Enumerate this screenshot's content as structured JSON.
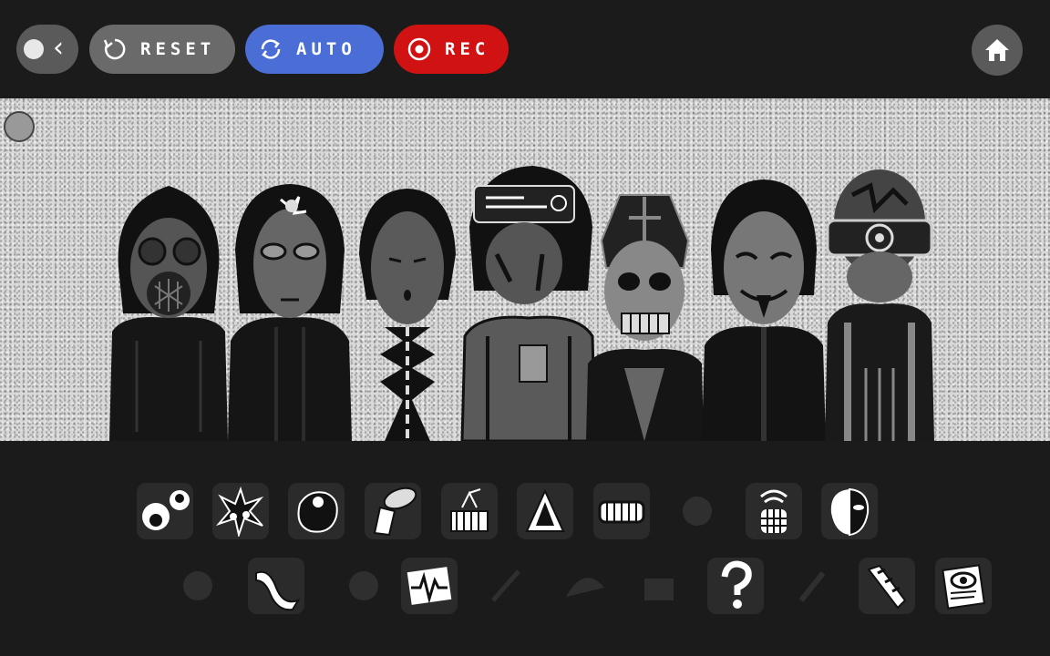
{
  "toolbar": {
    "reset_label": "RESET",
    "auto_label": "AUTO",
    "rec_label": "REC",
    "colors": {
      "reset": "#6a6a6a",
      "auto": "#4a6ed6",
      "rec": "#d01212"
    }
  },
  "stage": {
    "characters": [
      {
        "name": "gas-mask-character",
        "style": "active"
      },
      {
        "name": "cracked-head-character",
        "style": "active"
      },
      {
        "name": "chain-character",
        "style": "active"
      },
      {
        "name": "cyber-character",
        "style": "active"
      },
      {
        "name": "skull-character",
        "style": "active"
      },
      {
        "name": "masked-character",
        "style": "active"
      },
      {
        "name": "visor-character",
        "style": "active"
      }
    ]
  },
  "sounds": {
    "row1": [
      {
        "icon": "eyes-icon",
        "state": "available"
      },
      {
        "icon": "splat-icon",
        "state": "available"
      },
      {
        "icon": "blob-icon",
        "state": "available"
      },
      {
        "icon": "horn-icon",
        "state": "available"
      },
      {
        "icon": "drum-icon",
        "state": "available"
      },
      {
        "icon": "triangle-icon",
        "state": "available"
      },
      {
        "icon": "teeth-icon",
        "state": "available"
      },
      {
        "icon": "faded-icon",
        "state": "used"
      },
      {
        "icon": "signal-hand-icon",
        "state": "available"
      },
      {
        "icon": "half-mask-icon",
        "state": "available"
      }
    ],
    "row2": [
      {
        "icon": "faded-face-icon",
        "state": "used"
      },
      {
        "icon": "wave-icon",
        "state": "available"
      },
      {
        "icon": "faded-blob-icon",
        "state": "used"
      },
      {
        "icon": "heartbeat-icon",
        "state": "available"
      },
      {
        "icon": "faded-stick-icon",
        "state": "used"
      },
      {
        "icon": "faded-wing-icon",
        "state": "used"
      },
      {
        "icon": "faded-drum-icon",
        "state": "used"
      },
      {
        "icon": "question-icon",
        "state": "available"
      },
      {
        "icon": "faded-mic-icon",
        "state": "used"
      },
      {
        "icon": "cable-icon",
        "state": "available"
      },
      {
        "icon": "eye-document-icon",
        "state": "available"
      }
    ]
  }
}
